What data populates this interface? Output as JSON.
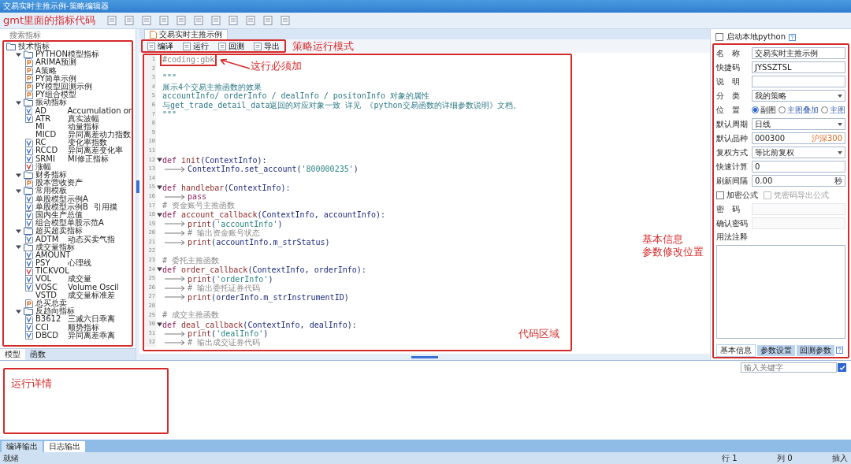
{
  "window": {
    "title": "交易实时主推示例-策略编辑器"
  },
  "left": {
    "search_placeholder": "搜索指标",
    "tree": [
      {
        "label": "技术指标",
        "expanded": true,
        "children": [
          {
            "label": "PYTHON模型指标",
            "expanded": true,
            "children": [
              {
                "kind": "py",
                "name": "ARIMA预测"
              },
              {
                "kind": "py",
                "name": "A策略"
              },
              {
                "kind": "py",
                "name": "PY简单示例"
              },
              {
                "kind": "py",
                "name": "PY模型回测示例"
              },
              {
                "kind": "py",
                "name": "PY组合模型"
              }
            ]
          },
          {
            "label": "振动指标",
            "expanded": true,
            "children": [
              {
                "kind": "v",
                "name": "AD",
                "desc": "Accumulation or"
              },
              {
                "kind": "v",
                "name": "ATR",
                "desc": "真实波幅"
              },
              {
                "kind": "none",
                "name": "MI",
                "desc": "动量指标"
              },
              {
                "kind": "none",
                "name": "MICD",
                "desc": "异同离差动力指数"
              },
              {
                "kind": "v",
                "name": "RC",
                "desc": "变化率指数"
              },
              {
                "kind": "v",
                "name": "RCCD",
                "desc": "异同离差变化率"
              },
              {
                "kind": "v",
                "name": "SRMI",
                "desc": "MI修正指标"
              },
              {
                "kind": "sv",
                "name": "涨幅"
              }
            ]
          },
          {
            "label": "财务指标",
            "expanded": true,
            "children": [
              {
                "kind": "py",
                "name": "股本营收资产"
              }
            ]
          },
          {
            "label": "常用模板",
            "expanded": true,
            "children": [
              {
                "kind": "v",
                "name": "单股模型示例A"
              },
              {
                "kind": "v",
                "name": "单股模型示例B",
                "desc": "引用摸"
              },
              {
                "kind": "v",
                "name": "国内生产总值"
              },
              {
                "kind": "v",
                "name": "组合模型单股示范A"
              }
            ]
          },
          {
            "label": "超买超卖指标",
            "expanded": true,
            "children": [
              {
                "kind": "v",
                "name": "ADTM",
                "desc": "动态买卖气指"
              }
            ]
          },
          {
            "label": "成交量指标",
            "expanded": true,
            "children": [
              {
                "kind": "v",
                "name": "AMOUNT"
              },
              {
                "kind": "v",
                "name": "PSY",
                "desc": "心理线"
              },
              {
                "kind": "sv",
                "name": "TICKVOL"
              },
              {
                "kind": "v",
                "name": "VOL",
                "desc": "成交量"
              },
              {
                "kind": "v",
                "name": "VOSC",
                "desc": "Volume Oscil"
              },
              {
                "kind": "none",
                "name": "VSTD",
                "desc": "成交量标准差"
              },
              {
                "kind": "py",
                "name": "总买总卖"
              }
            ]
          },
          {
            "label": "反趋向指标",
            "expanded": true,
            "children": [
              {
                "kind": "v",
                "name": "B3612",
                "desc": "三减六日乖离"
              },
              {
                "kind": "v",
                "name": "CCI",
                "desc": "顺势指标"
              },
              {
                "kind": "v",
                "name": "DBCD",
                "desc": "异同离差乖离"
              }
            ]
          }
        ]
      }
    ],
    "tabs": [
      {
        "label": "模型",
        "selected": true
      },
      {
        "label": "函数",
        "selected": false
      }
    ]
  },
  "editor": {
    "tab": "交易实时主推示例",
    "actions": [
      "编译",
      "运行",
      "回测",
      "导出"
    ],
    "lines": [
      {
        "no": "1",
        "annotated": true,
        "parts": [
          {
            "t": "#coding:gbk",
            "kind": "comment"
          }
        ]
      },
      {
        "no": "2"
      },
      {
        "no": "3",
        "parts": [
          {
            "t": "\"\"\"",
            "kind": "doc"
          }
        ]
      },
      {
        "no": "4",
        "parts": [
          {
            "t": "展示4个交易主推函数的效果",
            "kind": "doc"
          }
        ]
      },
      {
        "no": "5",
        "parts": [
          {
            "t": "accountInfo/ orderInfo / dealInfo / positonInfo 对象的属性",
            "kind": "doc"
          }
        ]
      },
      {
        "no": "6",
        "parts": [
          {
            "t": "与get_trade_detail_data返回的对应对象一致 详见 《python交易函数的详细参数说明》文档。",
            "kind": "doc"
          }
        ]
      },
      {
        "no": "7",
        "parts": [
          {
            "t": "\"\"\"",
            "kind": "doc"
          }
        ]
      },
      {
        "no": "8"
      },
      {
        "no": "9"
      },
      {
        "no": "10"
      },
      {
        "no": "11"
      },
      {
        "no": "12",
        "fold": true,
        "parts": [
          {
            "t": "def",
            "kind": "kw"
          },
          {
            "t": " init",
            "kind": "fn"
          },
          {
            "t": "(ContextInfo):",
            "kind": "plain"
          }
        ]
      },
      {
        "no": "13",
        "indent": true,
        "parts": [
          {
            "t": "ContextInfo.set_account(",
            "kind": "plain"
          },
          {
            "t": "'800000235'",
            "kind": "str"
          },
          {
            "t": ")",
            "kind": "plain"
          }
        ]
      },
      {
        "no": "14"
      },
      {
        "no": "15",
        "fold": true,
        "parts": [
          {
            "t": "def",
            "kind": "kw"
          },
          {
            "t": " handlebar",
            "kind": "fn"
          },
          {
            "t": "(ContextInfo):",
            "kind": "plain"
          }
        ]
      },
      {
        "no": "16",
        "indent": true,
        "parts": [
          {
            "t": "pass",
            "kind": "kw"
          }
        ]
      },
      {
        "no": "17",
        "parts": [
          {
            "t": "# 资金账号主推函数",
            "kind": "comment"
          }
        ]
      },
      {
        "no": "18",
        "fold": true,
        "parts": [
          {
            "t": "def",
            "kind": "kw"
          },
          {
            "t": " account_callback",
            "kind": "fn"
          },
          {
            "t": "(ContextInfo, accountInfo):",
            "kind": "plain"
          }
        ]
      },
      {
        "no": "19",
        "indent": true,
        "parts": [
          {
            "t": "print",
            "kind": "fn"
          },
          {
            "t": "(",
            "kind": "plain"
          },
          {
            "t": "'accountInfo'",
            "kind": "str"
          },
          {
            "t": ")",
            "kind": "plain"
          }
        ]
      },
      {
        "no": "20",
        "indent": true,
        "parts": [
          {
            "t": "# 输出资金账号状态",
            "kind": "comment"
          }
        ]
      },
      {
        "no": "21",
        "indent": true,
        "parts": [
          {
            "t": "print",
            "kind": "fn"
          },
          {
            "t": "(accountInfo.m_strStatus)",
            "kind": "plain"
          }
        ]
      },
      {
        "no": "22"
      },
      {
        "no": "23",
        "parts": [
          {
            "t": "# 委托主推函数",
            "kind": "comment"
          }
        ]
      },
      {
        "no": "24",
        "fold": true,
        "parts": [
          {
            "t": "def",
            "kind": "kw"
          },
          {
            "t": " order_callback",
            "kind": "fn"
          },
          {
            "t": "(ContextInfo, orderInfo):",
            "kind": "plain"
          }
        ]
      },
      {
        "no": "25",
        "indent": true,
        "parts": [
          {
            "t": "print",
            "kind": "fn"
          },
          {
            "t": "(",
            "kind": "plain"
          },
          {
            "t": "'orderInfo'",
            "kind": "str"
          },
          {
            "t": ")",
            "kind": "plain"
          }
        ]
      },
      {
        "no": "26",
        "indent": true,
        "parts": [
          {
            "t": "# 输出委托证券代码",
            "kind": "comment"
          }
        ]
      },
      {
        "no": "27",
        "indent": true,
        "parts": [
          {
            "t": "print",
            "kind": "fn"
          },
          {
            "t": "(orderInfo.m_strInstrumentID)",
            "kind": "plain"
          }
        ]
      },
      {
        "no": "28"
      },
      {
        "no": "29",
        "parts": [
          {
            "t": "# 成交主推函数",
            "kind": "comment"
          }
        ]
      },
      {
        "no": "30",
        "fold": true,
        "parts": [
          {
            "t": "def",
            "kind": "kw"
          },
          {
            "t": " deal_callback",
            "kind": "fn"
          },
          {
            "t": "(ContextInfo, dealInfo):",
            "kind": "plain"
          }
        ]
      },
      {
        "no": "31",
        "indent": true,
        "parts": [
          {
            "t": "print",
            "kind": "fn"
          },
          {
            "t": "(",
            "kind": "plain"
          },
          {
            "t": "'dealInfo'",
            "kind": "str"
          },
          {
            "t": ")",
            "kind": "plain"
          }
        ]
      },
      {
        "no": "32",
        "indent": true,
        "parts": [
          {
            "t": "# 输出成交证券代码",
            "kind": "comment"
          }
        ]
      }
    ]
  },
  "info": {
    "python_check": {
      "label": "启动本地python",
      "checked": false
    },
    "fields": [
      {
        "kind": "text",
        "label": "名　称",
        "value": "交易实时主推示例"
      },
      {
        "kind": "text",
        "label": "快捷码",
        "value": "JYSSZTSL"
      },
      {
        "kind": "text",
        "label": "说　明"
      },
      {
        "kind": "select",
        "label": "分　类",
        "value": "我的策略"
      },
      {
        "kind": "radio",
        "label": "位　置",
        "options": [
          {
            "label": "副图",
            "selected": true
          },
          {
            "label": "主图叠加",
            "selected": false
          },
          {
            "label": "主图",
            "selected": false
          }
        ]
      },
      {
        "kind": "select",
        "label": "默认周期",
        "value": "日线"
      },
      {
        "kind": "tagged",
        "label": "默认品种",
        "value": "000300",
        "tag": "沪深300"
      },
      {
        "kind": "select",
        "label": "复权方式",
        "value": "等比前复权"
      },
      {
        "kind": "text",
        "label": "快速计算",
        "value": "0"
      },
      {
        "kind": "unit",
        "label": "刷新间隔",
        "value": "0.00",
        "unit": "秒"
      },
      {
        "kind": "checks",
        "options": [
          {
            "label": "加密公式",
            "checked": false,
            "disabled": false
          },
          {
            "label": "凭密码导出公式",
            "checked": false,
            "disabled": true
          }
        ]
      },
      {
        "kind": "password",
        "label": "密　码",
        "disabled": true
      },
      {
        "kind": "password",
        "label": "确认密码",
        "disabled": true
      },
      {
        "kind": "textarea",
        "label": "用法注释"
      }
    ],
    "tabs": [
      {
        "label": "基本信息",
        "selected": true
      },
      {
        "label": "参数设置",
        "selected": false
      },
      {
        "label": "回测参数",
        "selected": false
      }
    ],
    "search_placeholder": "输入关键字"
  },
  "output": {
    "tabs": [
      {
        "label": "编译输出",
        "selected": false
      },
      {
        "label": "日志输出",
        "selected": true
      }
    ]
  },
  "status_bar": {
    "state": "就绪",
    "line": "行 1",
    "column": "列 0",
    "mode": "插入"
  },
  "annotations": {
    "tree": "gmt里面的指标代码",
    "mode": "策略运行模式",
    "coding": "这行必须加",
    "code": "代码区域",
    "info": [
      "基本信息",
      "参数修改位置"
    ],
    "output": "运行详情"
  }
}
